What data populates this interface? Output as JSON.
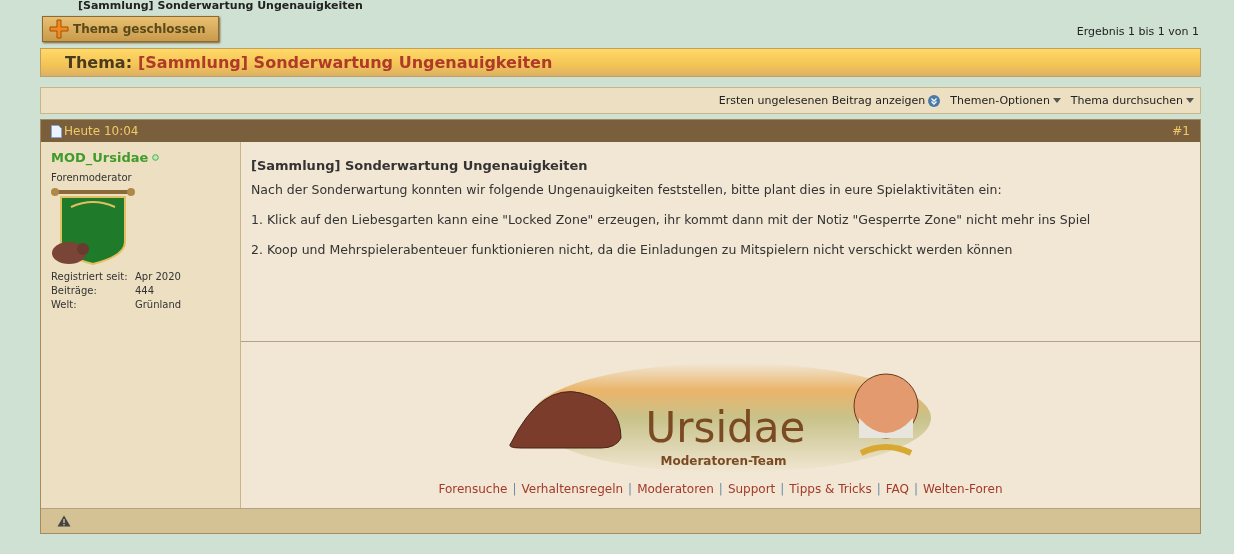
{
  "breadcrumb": {
    "text": "[Sammlung] Sonderwartung Ungenauigkeiten"
  },
  "closed_button": {
    "label": "Thema geschlossen"
  },
  "pagination": {
    "text": "Ergebnis 1 bis 1 von 1"
  },
  "thread_title": {
    "prefix": "Thema:",
    "title": "[Sammlung] Sonderwartung Ungenauigkeiten"
  },
  "toolbar": [
    {
      "label": "Ersten ungelesenen Beitrag anzeigen",
      "kind": "jump"
    },
    {
      "label": "Themen-Optionen",
      "kind": "menu"
    },
    {
      "label": "Thema durchsuchen",
      "kind": "menu"
    }
  ],
  "post": {
    "date": "Heute 10:04",
    "number": "#1",
    "author": {
      "name": "MOD_Ursidae",
      "online": true,
      "rank": "Forenmoderator",
      "details": [
        {
          "label": "Registriert seit:",
          "value": "Apr 2020"
        },
        {
          "label": "Beiträge:",
          "value": "444"
        },
        {
          "label": "Welt:",
          "value": "Grünland"
        }
      ]
    },
    "title": "[Sammlung] Sonderwartung Ungenauigkeiten",
    "paragraphs": [
      "Nach der Sonderwartung konnten wir folgende Ungenauigkeiten feststellen, bitte plant dies in eure Spielaktivitäten ein:",
      "1. Klick auf den Liebesgarten kann eine \"Locked Zone\" erzeugen, ihr kommt dann mit der Notiz \"Gesperrte Zone\" nicht mehr ins Spiel",
      "2. Koop und Mehrspielerabenteuer funktionieren nicht, da die Einladungen zu Mitspielern nicht verschickt werden können"
    ],
    "signature": {
      "banner_title": "Ursidae",
      "banner_subtitle": "Moderatoren-Team",
      "separator": "|",
      "links": [
        "Forensuche",
        "Verhaltensregeln",
        "Moderatoren",
        "Support",
        "Tipps & Tricks",
        "FAQ",
        "Welten-Foren"
      ]
    }
  }
}
